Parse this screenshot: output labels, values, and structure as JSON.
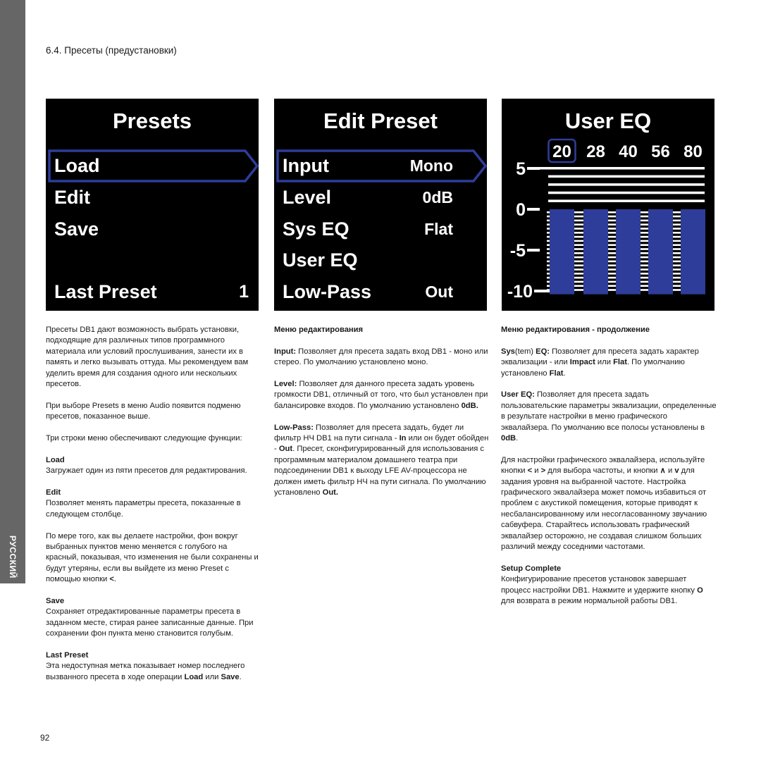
{
  "language_tab": "РУССКИЙ",
  "section_title": "6.4. Пресеты (предустановки)",
  "page_number": "92",
  "colors": {
    "accent_blue": "#2e3d9a",
    "screen_bg": "#000000",
    "strip_gray": "#666666"
  },
  "screens": {
    "presets": {
      "title": "Presets",
      "items": [
        {
          "label": "Load",
          "value": "",
          "selected": true
        },
        {
          "label": "Edit",
          "value": ""
        },
        {
          "label": "Save",
          "value": ""
        },
        {
          "label": "Last Preset",
          "value": "1"
        }
      ]
    },
    "edit_preset": {
      "title": "Edit Preset",
      "items": [
        {
          "label": "Input",
          "value": "Mono",
          "selected": true
        },
        {
          "label": "Level",
          "value": "0dB"
        },
        {
          "label": "Sys EQ",
          "value": "Flat"
        },
        {
          "label": "User EQ",
          "value": ""
        },
        {
          "label": "Low-Pass",
          "value": "Out"
        }
      ]
    },
    "user_eq": {
      "title": "User EQ",
      "bands": [
        "20",
        "28",
        "40",
        "56",
        "80"
      ],
      "selected_band": "20",
      "levels_db": [
        0,
        0,
        0,
        0,
        0
      ],
      "y_ticks": [
        "5",
        "0",
        "-5",
        "-10"
      ],
      "y_range_db": [
        -10,
        5
      ]
    }
  },
  "columns": [
    [
      {
        "type": "p",
        "segs": [
          [
            "Пресеты DB1 дают возможность выбрать установки, подходящие для различных типов программного материала или условий прослушивания, занести их в память и легко вызывать оттуда. Мы рекомендуем вам уделить время для создания одного или нескольких пресетов.",
            0
          ]
        ]
      },
      {
        "type": "p",
        "segs": [
          [
            "При выборе Presets в меню Audio появится подменю пресетов, показанное выше.",
            0
          ]
        ]
      },
      {
        "type": "p",
        "segs": [
          [
            "Три строки меню обеспечивают следующие функции:",
            0
          ]
        ]
      },
      {
        "type": "hp",
        "head": "Load",
        "segs": [
          [
            "Загружает один из пяти пресетов для редактирования.",
            0
          ]
        ]
      },
      {
        "type": "hp",
        "head": "Edit",
        "segs": [
          [
            "Позволяет менять параметры пресета, показанные в следующем столбце.",
            0
          ]
        ]
      },
      {
        "type": "p",
        "segs": [
          [
            "По мере того, как вы делаете настройки, фон вокруг выбранных пунктов меню меняется с голубого на красный, показывая, что изменения не были сохранены и будут утеряны, если вы выйдете из меню Preset с помощью кнопки ",
            0
          ],
          [
            "<",
            1
          ],
          [
            ".",
            0
          ]
        ]
      },
      {
        "type": "hp",
        "head": "Save",
        "segs": [
          [
            "Сохраняет отредактированные параметры пресета в заданном месте, стирая ранее записанные данные. При сохранении фон пункта меню становится голубым.",
            0
          ]
        ]
      },
      {
        "type": "hp",
        "head": "Last Preset",
        "segs": [
          [
            "Эта недоступная метка показывает номер последнего вызванного пресета в ходе операции ",
            0
          ],
          [
            "Load",
            1
          ],
          [
            " или ",
            0
          ],
          [
            "Save",
            1
          ],
          [
            ".",
            0
          ]
        ]
      }
    ],
    [
      {
        "type": "p",
        "segs": [
          [
            "Меню редактирования",
            1
          ]
        ]
      },
      {
        "type": "p",
        "segs": [
          [
            "Input:",
            1
          ],
          [
            " Позволяет для пресета задать вход DB1 - моно или стерео. По умолчанию установлено моно.",
            0
          ]
        ]
      },
      {
        "type": "p",
        "segs": [
          [
            "Level:",
            1
          ],
          [
            " Позволяет для данного пресета задать уровень громкости DB1, отличный от того, что был установлен при балансировке входов. По умолчанию установлено ",
            0
          ],
          [
            "0dB.",
            1
          ]
        ]
      },
      {
        "type": "p",
        "segs": [
          [
            "Low-Pass:",
            1
          ],
          [
            " Позволяет для пресета задать, будет ли фильтр НЧ DB1 на пути сигнала - ",
            0
          ],
          [
            "In",
            1
          ],
          [
            " или он будет обойден - ",
            0
          ],
          [
            "Out",
            1
          ],
          [
            ". Пресет, сконфигурированный для использования с программным материалом домашнего театра при подсоединении DB1 к выходу LFE AV-процессора не должен иметь фильтр НЧ на пути сигнала. По умолчанию установлено ",
            0
          ],
          [
            "Out.",
            1
          ]
        ]
      }
    ],
    [
      {
        "type": "p",
        "segs": [
          [
            "Меню редактирования - продолжение",
            1
          ]
        ]
      },
      {
        "type": "p",
        "segs": [
          [
            "Sys",
            1
          ],
          [
            "(tem) ",
            0
          ],
          [
            "EQ:",
            1
          ],
          [
            " Позволяет для пресета задать характер эквализации - или ",
            0
          ],
          [
            "Impact",
            1
          ],
          [
            " или ",
            0
          ],
          [
            "Flat",
            1
          ],
          [
            ". По умолчанию установлено ",
            0
          ],
          [
            "Flat",
            1
          ],
          [
            ".",
            0
          ]
        ]
      },
      {
        "type": "p",
        "segs": [
          [
            "User EQ:",
            1
          ],
          [
            " Позволяет для пресета задать пользовательские параметры эквализации, определенные в результате настройки в меню графического эквалайзера. По умолчанию все полосы установлены в ",
            0
          ],
          [
            "0dB",
            1
          ],
          [
            ".",
            0
          ]
        ]
      },
      {
        "type": "p",
        "segs": [
          [
            "Для настройки графического эквалайзера, используйте кнопки ",
            0
          ],
          [
            "<",
            1
          ],
          [
            " и ",
            0
          ],
          [
            ">",
            1
          ],
          [
            " для выбора частоты, и кнопки ",
            0
          ],
          [
            "∧",
            1
          ],
          [
            " и ",
            0
          ],
          [
            "v",
            1
          ],
          [
            " для задания уровня на выбранной частоте. Настройка графического эквалайзера может помочь избавиться от проблем с акустикой помещения, которые приводят к несбалансированному или несогласованному звучанию сабвуфера. Старайтесь использовать графический эквалайзер осторожно, не создавая слишком больших различий между соседними частотами.",
            0
          ]
        ]
      },
      {
        "type": "hp",
        "head": "Setup Complete",
        "segs": [
          [
            "Конфигурирование пресетов установок завершает процесс настройки DB1. Нажмите и удержите кнопку ",
            0
          ],
          [
            "O",
            1
          ],
          [
            " для возврата в режим нормальной работы DB1.",
            0
          ]
        ]
      }
    ]
  ]
}
